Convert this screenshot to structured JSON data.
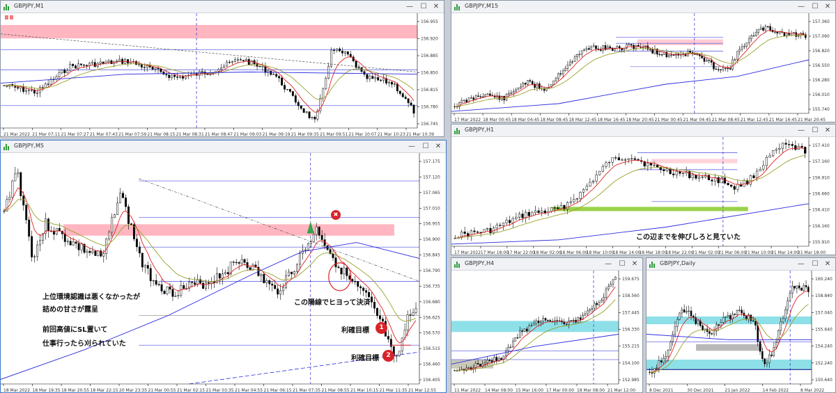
{
  "colors": {
    "bull": "#ffffff",
    "bear": "#000000",
    "ma_fast": "#e02020",
    "ma_mid": "#9aa02a",
    "ma_slow": "#2a2ae0",
    "zone_pink": "#ffb6c1",
    "zone_cyan": "#8ee0e8",
    "zone_green": "#9ad24a",
    "badge_red": "#d8232a",
    "arrow_green": "#35a04a"
  },
  "windows": {
    "m1": {
      "title": "GBPJPY,M1",
      "legend": "▮▮▮",
      "prices": [
        "156.955",
        "156.920",
        "156.885",
        "156.850",
        "156.815",
        "156.780",
        "156.745"
      ],
      "times": [
        "21 Mar 2022",
        "21 Mar 07:11",
        "21 Mar 07:27",
        "21 Mar 07:43",
        "21 Mar 07:59",
        "21 Mar 08:15",
        "21 Mar 08:31",
        "21 Mar 08:47",
        "21 Mar 09:03",
        "21 Mar 09:19",
        "21 Mar 09:35",
        "21 Mar 09:51",
        "21 Mar 10:07",
        "21 Mar 10:23",
        "21 Mar 10:39"
      ],
      "level_tags": [
        "sl",
        "tp"
      ]
    },
    "m5": {
      "title": "GBPJPY,M5",
      "prices": [
        "157.175",
        "157.120",
        "157.065",
        "157.010",
        "156.955",
        "156.900",
        "156.845",
        "156.790",
        "156.735",
        "156.680",
        "156.625",
        "156.570",
        "156.515",
        "156.460",
        "156.405"
      ],
      "times": [
        "18 Mar 2022",
        "18 Mar 19:35",
        "18 Mar 20:55",
        "18 Mar 22:15",
        "20 Mar 23:35",
        "21 Mar 00:55",
        "21 Mar 02:15",
        "21 Mar 03:35",
        "21 Mar 04:55",
        "21 Mar 06:15",
        "21 Mar 07:35",
        "21 Mar 08:55",
        "21 Mar 10:15",
        "21 Mar 11:35",
        "21 Mar 12:55"
      ],
      "level_tags": [
        "sl",
        "tp"
      ],
      "note_env": "上位環境認識は悪くなかったが",
      "note_env2": "詰めの甘さが露呈",
      "note_sl": "前回高値にSL置いて",
      "note_sl2": "仕事行ったら刈られていた",
      "note_exit": "この陽線でヒヨって決済",
      "tp1_label": "利確目標",
      "tp2_label": "利確目標",
      "tp1_num": "1",
      "tp2_num": "2",
      "cross": "✖"
    },
    "m15": {
      "title": "GBPJPY,M15",
      "prices": [
        "157.360",
        "157.090",
        "156.820",
        "156.550",
        "156.280",
        "156.010",
        "155.740"
      ],
      "times": [
        "17 Mar 2022",
        "18 Mar 00:45",
        "18 Mar 04:45",
        "18 Mar 08:45",
        "18 Mar 12:45",
        "18 Mar 16:45",
        "18 Mar 20:45",
        "21 Mar 00:45",
        "21 Mar 04:45",
        "21 Mar 08:45",
        "21 Mar 12:45",
        "21 Mar 16:45",
        "21 Mar 20:45"
      ]
    },
    "h1": {
      "title": "GBPJPY,H1",
      "prices": [
        "157.410",
        "157.160",
        "156.910",
        "156.660",
        "156.410",
        "156.160",
        "155.910"
      ],
      "times": [
        "17 Mar 2022",
        "17 Mar 18:00",
        "17 Mar 22:00",
        "18 Mar 02:00",
        "18 Mar 06:00",
        "18 Mar 10:00",
        "18 Mar 14:00",
        "18 Mar 18:00",
        "18 Mar 22:00",
        "21 Mar 02:00",
        "21 Mar 06:00",
        "21 Mar 10:00",
        "21 Mar 14:00",
        "21 Mar 18:00"
      ],
      "note": "この辺までを伸びしろと見ていた"
    },
    "h4": {
      "title": "GBPJPY,H4",
      "prices": [
        "159.675",
        "158.560",
        "157.445",
        "156.330",
        "155.215",
        "154.100",
        "152.985"
      ],
      "times": [
        "11 Mar 2022",
        "14 Mar 08:00",
        "15 Mar 16:00",
        "17 Mar 00:00",
        "18 Mar 08:00",
        "21 Mar 12:00"
      ]
    },
    "d1": {
      "title": "GBPJPY,Daily",
      "prices": [
        "160.240",
        "158.840",
        "157.040",
        "155.640",
        "154.240",
        "152.240",
        "150.640"
      ],
      "times": [
        "8 Dec 2021",
        "30 Dec 2021",
        "21 Jan 2022",
        "14 Feb 2022",
        "8 Mar 2022"
      ]
    }
  },
  "buttons": {
    "minimize": "—",
    "maximize": "☐",
    "close": "✕"
  }
}
